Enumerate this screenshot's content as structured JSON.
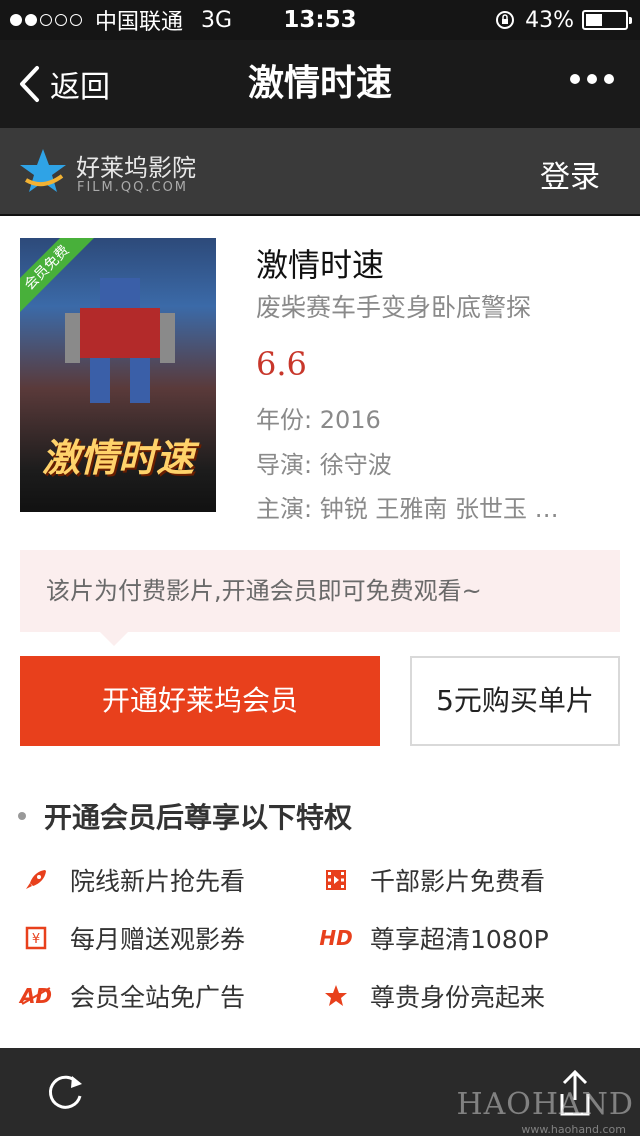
{
  "status_bar": {
    "signal_dots_full": 2,
    "signal_dots_total": 5,
    "carrier": "中国联通",
    "network": "3G",
    "time": "13:53",
    "battery_percent": "43%",
    "battery_level": 0.43
  },
  "nav": {
    "back_label": "返回",
    "title": "激情时速",
    "more_icon": "more-dots-icon"
  },
  "brand": {
    "name": "好莱坞影院",
    "url": "FILM.QQ.COM",
    "login_label": "登录"
  },
  "movie": {
    "ribbon": "会员免费",
    "poster_title": "激情时速",
    "title": "激情时速",
    "tagline": "废柴赛车手变身卧底警探",
    "score": "6.6",
    "year_label": "年份:",
    "year": "2016",
    "director_label": "导演:",
    "director": "徐守波",
    "cast_label": "主演:",
    "cast": "钟锐 王雅南 张世玉 …"
  },
  "notice": {
    "text": "该片为付费影片,开通会员即可免费观看~"
  },
  "actions": {
    "member_label": "开通好莱坞会员",
    "buy_label": "5元购买单片"
  },
  "benefits": {
    "heading": "开通会员后尊享以下特权",
    "items": [
      {
        "icon": "rocket-icon",
        "label": "院线新片抢先看"
      },
      {
        "icon": "film-icon",
        "label": "千部影片免费看"
      },
      {
        "icon": "ticket-icon",
        "label": "每月赠送观影券"
      },
      {
        "icon": "hd-icon",
        "label": "尊享超清1080P",
        "badge": "HD"
      },
      {
        "icon": "no-ad-icon",
        "label": "会员全站免广告",
        "badge": "AD"
      },
      {
        "icon": "star-icon",
        "label": "尊贵身份亮起来"
      }
    ]
  },
  "watermark": {
    "text": "HAOHAND",
    "sub": "www.haohand.com"
  },
  "colors": {
    "accent": "#e8401c",
    "score": "#c8372b",
    "notice_bg": "#fbeeee",
    "nav_bg": "#1a1a1a",
    "brand_bg": "#3a3a3a"
  }
}
